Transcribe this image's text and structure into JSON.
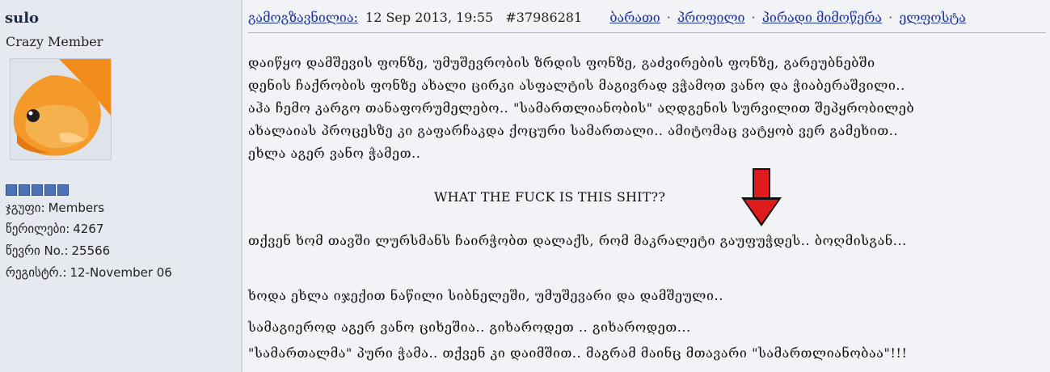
{
  "user": {
    "name": "sulo",
    "rank": "Crazy Member",
    "stats": [
      {
        "label": "ჯგუფი:",
        "value": "Members"
      },
      {
        "label": "წერილები:",
        "value": "4267"
      },
      {
        "label": "წევრი No.:",
        "value": "25566"
      },
      {
        "label": "რეგისტრ.:",
        "value": "12-November 06"
      }
    ],
    "rating_stars": 5
  },
  "post": {
    "sent_label": "გამოგზავნილია:",
    "datetime": "12 Sep 2013, 19:55",
    "post_id": "#37986281",
    "links": [
      "ბარათი",
      "პროფილი",
      "პირადი მიმოწერა",
      "ელფოსტა"
    ],
    "body_lines": [
      "დაიწყო დამშევის ფონზე, უმუშევრობის ზრდის ფონზე, გაძვირების ფონზე, გარეუბნებში",
      "დენის ჩაქრობის ფონზე ახალი ცირკი ასფალტის მაგივრად ვჭამოთ ვანო და ჭიაბერაშვილი..",
      "აჰა ჩემო კარგო თანაფორუმელებო.. \"სამართლიანობის\" აღდგენის სურვილით შეპყრობილებ",
      "ახალაიას პროცესზე კი გაფარჩაკდა ქოცური სამართალი.. ამიტომაც ვატყობ ვერ გამეხით..",
      "ეხლა აგერ ვანო ჭამეთ..",
      "თქვენ ხომ თავში ლურსმანს ჩაირჭობთ დალაქს, რომ მაკრალეტი გაუფუჭდეს.. ბოღმისგან...",
      "ხოდა ეხლა იჯექით ნაწილი სიბნელეში, უმუშევარი და დამშეული..",
      "სამაგიეროდ აგერ ვანო ციხეშია.. გიხაროდეთ .. გიხაროდეთ...",
      "\"სამართალმა\" პური ჭამა.. თქვენ კი დაიმშით.. მაგრამ მაინც მთავარი \"სამართლიანობაა\"!!!"
    ],
    "caption": "WHAT THE  FUCK IS THIS SHIT??",
    "arrow_color": "#e01b1b"
  }
}
